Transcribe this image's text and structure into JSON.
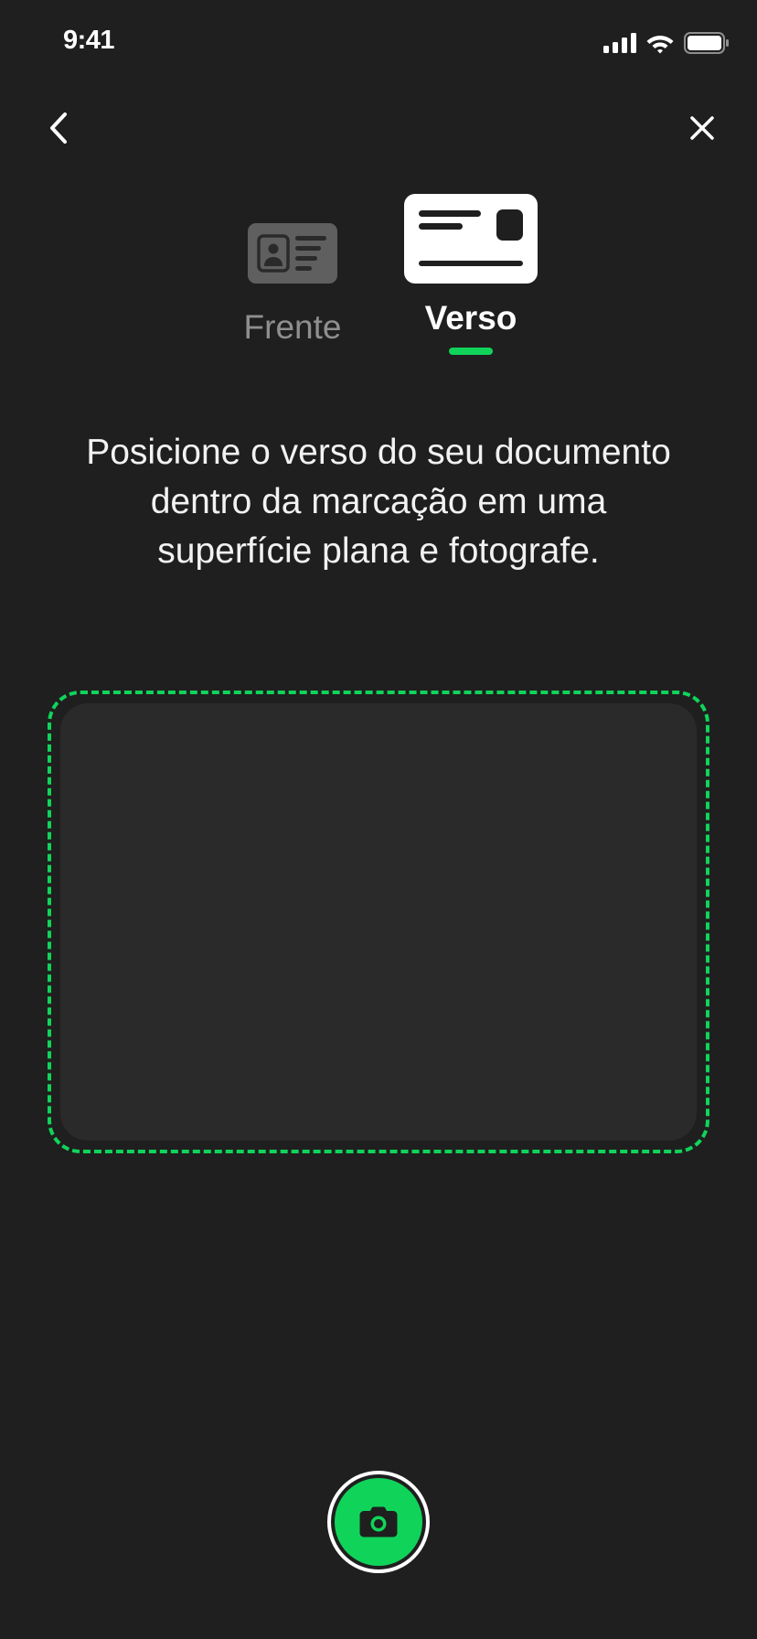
{
  "status_bar": {
    "time": "9:41",
    "icons": [
      "cellular-signal-icon",
      "wifi-icon",
      "battery-icon"
    ]
  },
  "nav": {
    "back_icon": "chevron-left-icon",
    "close_icon": "close-icon"
  },
  "tabs": [
    {
      "label": "Frente",
      "icon": "id-card-front-icon",
      "selected": false
    },
    {
      "label": "Verso",
      "icon": "id-card-back-icon",
      "selected": true
    }
  ],
  "instruction": {
    "line1": "Posicione o verso do seu documento",
    "line2": "dentro da marcação em uma",
    "line3": "superfície plana e fotografe."
  },
  "shutter": {
    "icon": "camera-icon"
  },
  "colors": {
    "background": "#1f1f1f",
    "accent": "#10d45a",
    "frame_fill": "#2a2a2a",
    "inactive_text": "#8f8f8f"
  }
}
